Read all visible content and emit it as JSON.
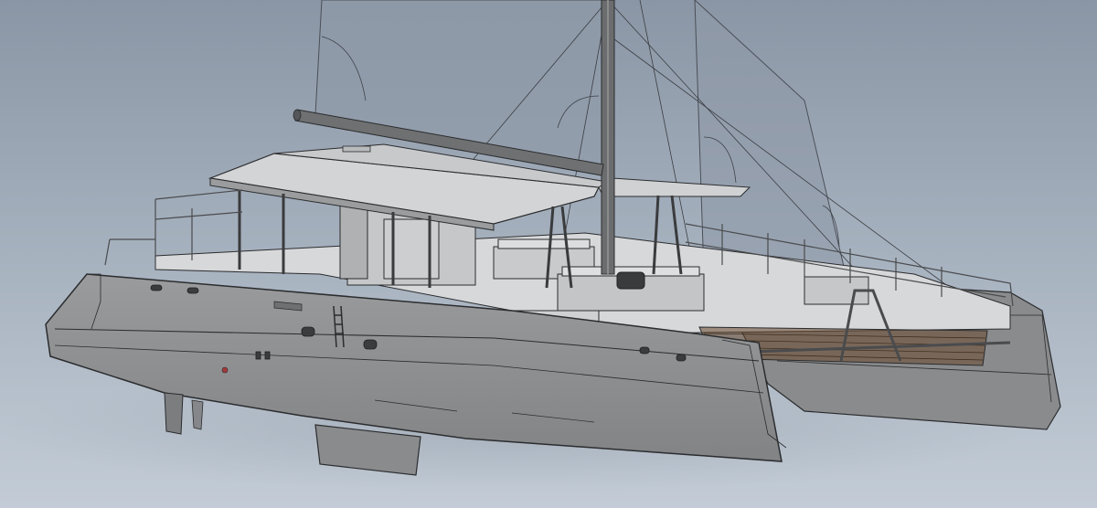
{
  "scene": {
    "subject": "catamaran-cad-render",
    "colors": {
      "bg_top": "#8a96a5",
      "bg_mid": "#a9b4c1",
      "bg_bottom": "#c3ccd6",
      "hull_side": "#8d8e90",
      "hull_dark": "#6f7072",
      "hull_light": "#aeafb1",
      "deck": "#d7d8da",
      "roof": "#d3d4d6",
      "sail": "#8f9aa8",
      "outline": "#2b2c2e",
      "mast": "#6b6c6e",
      "net": "#6a4a30"
    }
  }
}
